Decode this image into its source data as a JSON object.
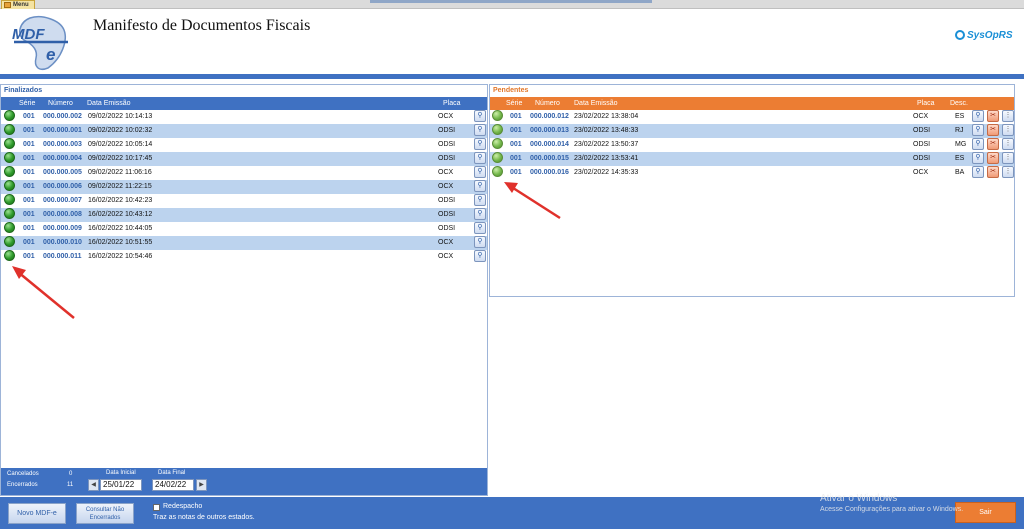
{
  "window": {
    "tab_label": "Menu"
  },
  "header": {
    "title": "Manifesto de Documentos Fiscais",
    "logo_text": "MDF-e",
    "brand": "SysOpRS"
  },
  "finalizados": {
    "title": "Finalizados",
    "columns": {
      "serie": "Série",
      "numero": "Número",
      "data": "Data Emissão",
      "placa": "Placa"
    },
    "rows": [
      {
        "serie": "001",
        "numero": "000.000.002",
        "data": "09/02/2022 10:14:13",
        "placa": "OCX"
      },
      {
        "serie": "001",
        "numero": "000.000.001",
        "data": "09/02/2022 10:02:32",
        "placa": "ODSI"
      },
      {
        "serie": "001",
        "numero": "000.000.003",
        "data": "09/02/2022 10:05:14",
        "placa": "ODSI"
      },
      {
        "serie": "001",
        "numero": "000.000.004",
        "data": "09/02/2022 10:17:45",
        "placa": "ODSI"
      },
      {
        "serie": "001",
        "numero": "000.000.005",
        "data": "09/02/2022 11:06:16",
        "placa": "OCX"
      },
      {
        "serie": "001",
        "numero": "000.000.006",
        "data": "09/02/2022 11:22:15",
        "placa": "OCX"
      },
      {
        "serie": "001",
        "numero": "000.000.007",
        "data": "16/02/2022 10:42:23",
        "placa": "ODSI"
      },
      {
        "serie": "001",
        "numero": "000.000.008",
        "data": "16/02/2022 10:43:12",
        "placa": "ODSI"
      },
      {
        "serie": "001",
        "numero": "000.000.009",
        "data": "16/02/2022 10:44:05",
        "placa": "ODSI"
      },
      {
        "serie": "001",
        "numero": "000.000.010",
        "data": "16/02/2022 10:51:55",
        "placa": "OCX"
      },
      {
        "serie": "001",
        "numero": "000.000.011",
        "data": "16/02/2022 10:54:46",
        "placa": "OCX"
      }
    ],
    "footer": {
      "cancelados_label": "Cancelados",
      "cancelados_value": "0",
      "encerrados_label": "Encerrados",
      "encerrados_value": "11",
      "data_inicial_label": "Data Inicial",
      "data_inicial_value": "25/01/22",
      "data_final_label": "Data Final",
      "data_final_value": "24/02/22"
    }
  },
  "pendentes": {
    "title": "Pendentes",
    "columns": {
      "serie": "Série",
      "numero": "Número",
      "data": "Data Emissão",
      "placa": "Placa",
      "desc": "Desc."
    },
    "rows": [
      {
        "serie": "001",
        "numero": "000.000.012",
        "data": "23/02/2022 13:38:04",
        "placa": "OCX",
        "desc": "ES"
      },
      {
        "serie": "001",
        "numero": "000.000.013",
        "data": "23/02/2022 13:48:33",
        "placa": "ODSI",
        "desc": "RJ"
      },
      {
        "serie": "001",
        "numero": "000.000.014",
        "data": "23/02/2022 13:50:37",
        "placa": "ODSI",
        "desc": "MG"
      },
      {
        "serie": "001",
        "numero": "000.000.015",
        "data": "23/02/2022 13:53:41",
        "placa": "ODSI",
        "desc": "ES"
      },
      {
        "serie": "001",
        "numero": "000.000.016",
        "data": "23/02/2022 14:35:33",
        "placa": "OCX",
        "desc": "BA"
      }
    ]
  },
  "bottombar": {
    "novo_label": "Novo MDF-e",
    "consultar_line1": "Consultar Não",
    "consultar_line2": "Encerrados",
    "redespacho_label": "Redespacho",
    "redespacho_hint": "Traz as notas de outros estados.",
    "sair_label": "Sair"
  },
  "watermark": {
    "line1": "Ativar o Windows",
    "line2": "Acesse Configurações para ativar o Windows."
  },
  "colors": {
    "blue": "#3f71c2",
    "orange": "#ec7d33",
    "status_green": "#2e9a2a"
  }
}
